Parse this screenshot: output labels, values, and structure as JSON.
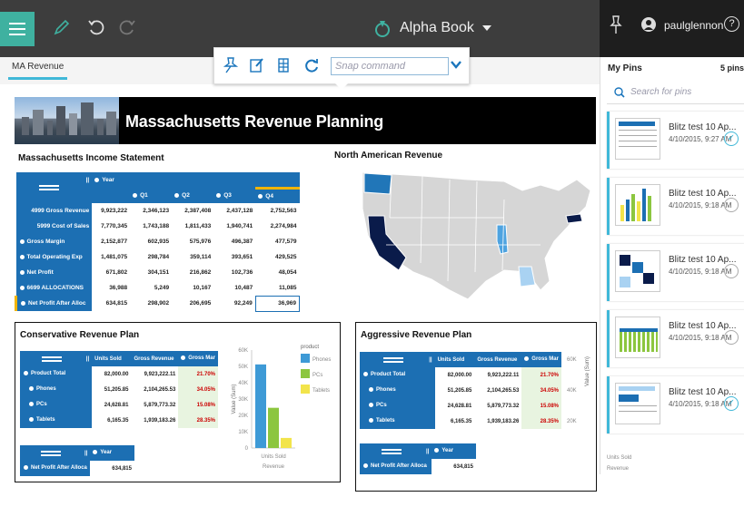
{
  "app": {
    "book_name": "Alpha Book",
    "user_name": "paulglennon"
  },
  "tab": {
    "label": "MA Revenue"
  },
  "toolbar": {
    "snap_placeholder": "Snap command"
  },
  "banner": {
    "title": "Massachusetts Revenue Planning"
  },
  "income": {
    "title": "Massachusetts Income Statement",
    "year_label": "Year",
    "columns": [
      "Q1",
      "Q2",
      "Q3",
      "Q4"
    ],
    "rows": [
      {
        "label": "4999 Gross Revenue",
        "values": [
          "9,923,222",
          "2,346,123",
          "2,387,408",
          "2,437,128",
          "2,752,563"
        ]
      },
      {
        "label": "5999 Cost of Sales",
        "values": [
          "7,770,345",
          "1,743,188",
          "1,811,433",
          "1,940,741",
          "2,274,984"
        ]
      },
      {
        "label": "Gross Margin",
        "values": [
          "2,152,877",
          "602,935",
          "575,976",
          "496,387",
          "477,579"
        ]
      },
      {
        "label": "Total Operating Exp",
        "values": [
          "1,481,075",
          "298,784",
          "359,114",
          "393,651",
          "429,525"
        ]
      },
      {
        "label": "Net Profit",
        "values": [
          "671,802",
          "304,151",
          "216,862",
          "102,736",
          "48,054"
        ]
      },
      {
        "label": "6699 ALLOCATIONS",
        "values": [
          "36,988",
          "5,249",
          "10,167",
          "10,487",
          "11,085"
        ]
      },
      {
        "label": "Net Profit After Alloc",
        "values": [
          "634,815",
          "298,902",
          "206,695",
          "92,249",
          "36,969"
        ]
      }
    ]
  },
  "map": {
    "title": "North American Revenue"
  },
  "conservative": {
    "title": "Conservative Revenue Plan",
    "columns": [
      "Units Sold",
      "Gross Revenue",
      "Gross Mar"
    ],
    "rows": [
      {
        "label": "Product Total",
        "values": [
          "82,000.00",
          "9,923,222.11",
          "21.70%"
        ]
      },
      {
        "label": "Phones",
        "values": [
          "51,205.85",
          "2,104,265.53",
          "34.05%"
        ]
      },
      {
        "label": "PCs",
        "values": [
          "24,628.81",
          "5,879,773.32",
          "15.08%"
        ]
      },
      {
        "label": "Tablets",
        "values": [
          "6,165.35",
          "1,939,183.26",
          "28.35%"
        ]
      }
    ],
    "year_label": "Year",
    "net_label": "Net Profit After Alloca",
    "net_value": "634,815",
    "chart": {
      "y_ticks": [
        "60K",
        "50K",
        "40K",
        "30K",
        "20K",
        "10K",
        "0"
      ],
      "ylabel": "Value (Sum)",
      "legend_title": "product",
      "legend": [
        "Phones",
        "PCs",
        "Tablets"
      ],
      "x_category": "Units Sold",
      "x_group": "Revenue"
    }
  },
  "aggressive": {
    "title": "Aggressive Revenue Plan",
    "columns": [
      "Units Sold",
      "Gross Revenue",
      "Gross Mar"
    ],
    "rows": [
      {
        "label": "Product Total",
        "values": [
          "82,000.00",
          "9,923,222.11",
          "21.70%"
        ]
      },
      {
        "label": "Phones",
        "values": [
          "51,205.85",
          "2,104,265.53",
          "34.05%"
        ]
      },
      {
        "label": "PCs",
        "values": [
          "24,628.81",
          "5,879,773.32",
          "15.08%"
        ]
      },
      {
        "label": "Tablets",
        "values": [
          "6,165.35",
          "1,939,183.26",
          "28.35%"
        ]
      }
    ],
    "year_label": "Year",
    "net_label": "Net Profit After Alloca",
    "net_value": "634,815",
    "chart": {
      "y_ticks": [
        "60K",
        "40K",
        "20K"
      ],
      "ylabel": "Value (Sum)"
    }
  },
  "pins": {
    "title": "My Pins",
    "count": "5 pins",
    "search_placeholder": "Search for pins",
    "items": [
      {
        "title": "Blitz test 10 Ap...",
        "date": "4/10/2015, 9:27 AM",
        "checked": true
      },
      {
        "title": "Blitz test 10 Ap...",
        "date": "4/10/2015, 9:18 AM",
        "checked": false
      },
      {
        "title": "Blitz test 10 Ap...",
        "date": "4/10/2015, 9:18 AM",
        "checked": false
      },
      {
        "title": "Blitz test 10 Ap...",
        "date": "4/10/2015, 9:18 AM",
        "checked": false
      },
      {
        "title": "Blitz test 10 Ap...",
        "date": "4/10/2015, 9:18 AM",
        "checked": true
      }
    ],
    "footer_line1": "Units Sold",
    "footer_line2": "Revenue"
  },
  "chart_data": {
    "type": "bar",
    "title": "",
    "xlabel": "Units Sold",
    "ylabel": "Value (Sum)",
    "categories": [
      "Phones",
      "PCs",
      "Tablets"
    ],
    "values": [
      51205.85,
      24628.81,
      6165.35
    ],
    "ylim": [
      0,
      60000
    ],
    "colors": [
      "#3e9ad6",
      "#8cc63f",
      "#f2e44b"
    ],
    "legend": "right",
    "grid": false
  },
  "colors": {
    "accent": "#3fb1a0",
    "grid_header": "#1c6fb3",
    "highlight": "#40b8d8"
  }
}
